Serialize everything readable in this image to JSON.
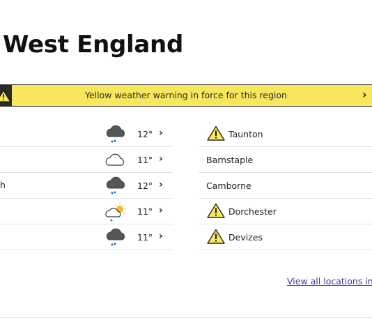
{
  "region": {
    "title": "West England"
  },
  "warning": {
    "text": "Yellow weather warning in force for this region",
    "chevron": "›",
    "icon": "warning-triangle-icon",
    "color": "#f8e75c"
  },
  "left_column": [
    {
      "name": "",
      "icon": "heavy-rain-cloud-icon",
      "temp": "12°",
      "chevron": "›"
    },
    {
      "name": "",
      "icon": "cloud-icon",
      "temp": "11°",
      "chevron": "›"
    },
    {
      "name": "h",
      "icon": "heavy-rain-cloud-icon",
      "temp": "12°",
      "chevron": "›"
    },
    {
      "name": "",
      "icon": "sun-cloud-rain-icon",
      "temp": "11°",
      "chevron": "›"
    },
    {
      "name": "",
      "icon": "heavy-rain-cloud-icon",
      "temp": "11°",
      "chevron": "›"
    }
  ],
  "right_column": [
    {
      "name": "Taunton",
      "warning": true
    },
    {
      "name": "Barnstaple",
      "warning": false
    },
    {
      "name": "Camborne",
      "warning": false
    },
    {
      "name": "Dorchester",
      "warning": true
    },
    {
      "name": "Devizes",
      "warning": true
    }
  ],
  "view_all": {
    "label": "View all locations in S"
  }
}
